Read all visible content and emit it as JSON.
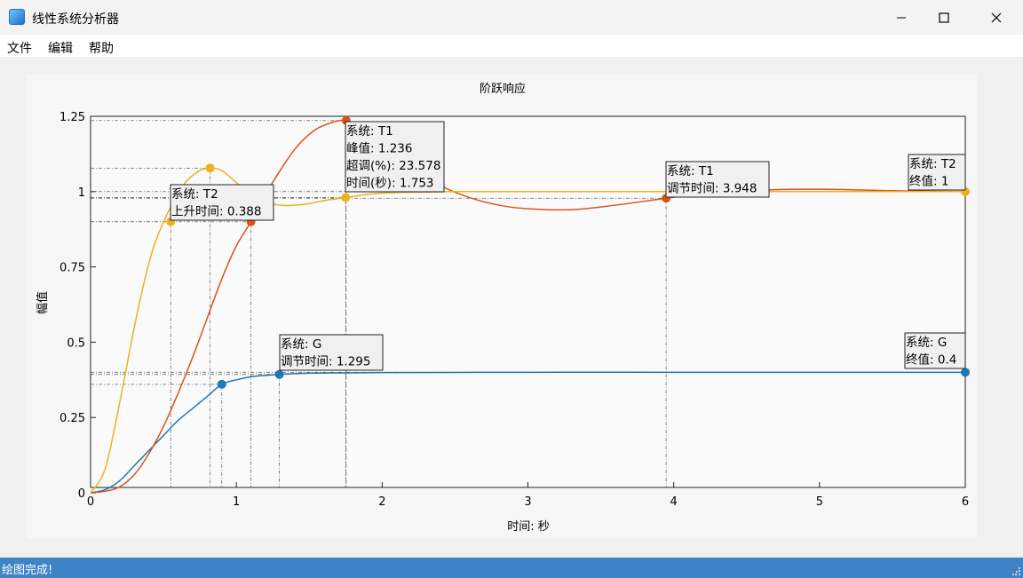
{
  "window": {
    "title": "线性系统分析器"
  },
  "menu": {
    "file": "文件",
    "edit": "编辑",
    "help": "帮助"
  },
  "status": {
    "text": "绘图完成!"
  },
  "colors": {
    "G": "#1f77b4",
    "T1": "#d95319",
    "T2": "#edb120",
    "statusbar": "#3e84c6"
  },
  "chart_data": {
    "type": "line",
    "title": "阶跃响应",
    "xlabel": "时间: 秒",
    "ylabel": "幅值",
    "xlim": [
      0,
      6
    ],
    "ylim": [
      0,
      1.25
    ],
    "xticks": [
      0,
      1,
      2,
      3,
      4,
      5,
      6
    ],
    "yticks": [
      0,
      0.25,
      0.5,
      0.75,
      1,
      1.25
    ],
    "ytick_labels": [
      "0",
      "0.25",
      "0.5",
      "0.75",
      "1",
      "1.25"
    ],
    "grid": false,
    "series": [
      {
        "name": "G",
        "color": "#1f77b4",
        "x": [
          0,
          0.1,
          0.2,
          0.3,
          0.4,
          0.5,
          0.6,
          0.7,
          0.8,
          0.9,
          1.0,
          1.1,
          1.2,
          1.295,
          1.5,
          2.0,
          3.0,
          4.0,
          5.0,
          6.0
        ],
        "y": [
          0,
          0.01,
          0.04,
          0.09,
          0.14,
          0.19,
          0.24,
          0.28,
          0.32,
          0.36,
          0.375,
          0.385,
          0.39,
          0.393,
          0.397,
          0.399,
          0.4,
          0.4,
          0.4,
          0.4
        ],
        "markers": [
          {
            "x": 0.9,
            "y": 0.36
          },
          {
            "x": 1.295,
            "y": 0.393
          },
          {
            "x": 6.0,
            "y": 0.4
          }
        ]
      },
      {
        "name": "T1",
        "color": "#d95319",
        "x": [
          0,
          0.1,
          0.2,
          0.3,
          0.4,
          0.5,
          0.6,
          0.7,
          0.8,
          0.9,
          1.0,
          1.1,
          1.2,
          1.3,
          1.4,
          1.5,
          1.6,
          1.753,
          1.9,
          2.0,
          2.2,
          2.4,
          2.6,
          2.8,
          3.0,
          3.3,
          3.6,
          3.948,
          4.2,
          4.6,
          5.0,
          5.5,
          6.0
        ],
        "y": [
          0,
          0.005,
          0.02,
          0.06,
          0.13,
          0.22,
          0.33,
          0.45,
          0.58,
          0.71,
          0.82,
          0.9,
          0.99,
          1.07,
          1.14,
          1.19,
          1.22,
          1.236,
          1.2,
          1.15,
          1.08,
          1.02,
          0.98,
          0.955,
          0.943,
          0.94,
          0.955,
          0.978,
          0.992,
          1.005,
          1.008,
          1.003,
          1.0
        ],
        "markers": [
          {
            "x": 1.1,
            "y": 0.9
          },
          {
            "x": 1.753,
            "y": 1.236
          },
          {
            "x": 3.948,
            "y": 0.978
          }
        ]
      },
      {
        "name": "T2",
        "color": "#edb120",
        "x": [
          0,
          0.1,
          0.2,
          0.3,
          0.388,
          0.45,
          0.55,
          0.65,
          0.75,
          0.82,
          0.9,
          1.0,
          1.1,
          1.2,
          1.3,
          1.4,
          1.5,
          1.6,
          1.75,
          2.0,
          2.5,
          3.0,
          4.0,
          5.0,
          6.0
        ],
        "y": [
          0,
          0.08,
          0.3,
          0.55,
          0.74,
          0.84,
          0.95,
          1.03,
          1.07,
          1.078,
          1.07,
          1.03,
          0.99,
          0.965,
          0.955,
          0.955,
          0.96,
          0.97,
          0.98,
          0.995,
          1.0,
          1.0,
          1.0,
          1.0,
          1.0
        ],
        "markers": [
          {
            "x": 0.55,
            "y": 0.9
          },
          {
            "x": 0.82,
            "y": 1.078
          },
          {
            "x": 1.75,
            "y": 0.98
          },
          {
            "x": 6.0,
            "y": 1.0
          }
        ]
      }
    ],
    "annotations": [
      {
        "lines": [
          "系统: T2",
          "上升时间: 0.388"
        ]
      },
      {
        "lines": [
          "系统: T1",
          "峰值: 1.236",
          "超调(%): 23.578",
          "时间(秒): 1.753"
        ]
      },
      {
        "lines": [
          "系统: T1",
          "调节时间: 3.948"
        ]
      },
      {
        "lines": [
          "系统: T2",
          "终值: 1"
        ]
      },
      {
        "lines": [
          "系统: G",
          "调节时间: 1.295"
        ]
      },
      {
        "lines": [
          "系统: G",
          "终值: 0.4"
        ]
      }
    ]
  }
}
